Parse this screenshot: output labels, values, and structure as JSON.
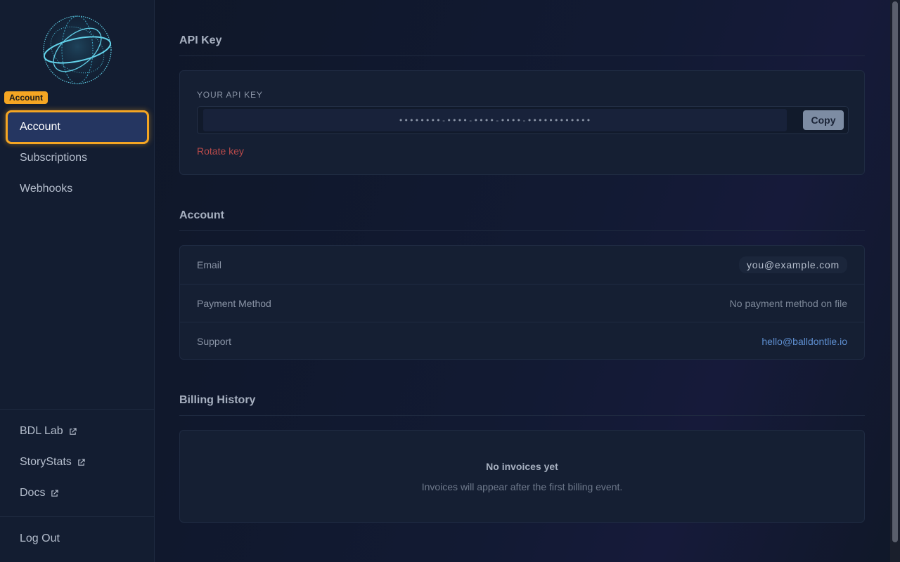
{
  "sidebar": {
    "tooltip": "Account",
    "nav": [
      {
        "label": "Account",
        "active": true
      },
      {
        "label": "Subscriptions",
        "active": false
      },
      {
        "label": "Webhooks",
        "active": false
      }
    ],
    "external_links": [
      {
        "label": "BDL Lab",
        "icon": "external-link-icon"
      },
      {
        "label": "StoryStats",
        "icon": "external-link-icon"
      },
      {
        "label": "Docs",
        "icon": "external-link-icon"
      }
    ],
    "logout_label": "Log Out"
  },
  "api_key": {
    "section_title": "API Key",
    "field_label": "YOUR API KEY",
    "masked_value": "••••••••-••••-••••-••••-••••••••••••",
    "copy_label": "Copy",
    "rotate_label": "Rotate key"
  },
  "account": {
    "section_title": "Account",
    "rows": [
      {
        "label": "Email",
        "value": "you@example.com"
      },
      {
        "label": "Payment Method",
        "value": "No payment method on file"
      },
      {
        "label": "Support",
        "value": "hello@balldontlie.io"
      }
    ]
  },
  "billing": {
    "section_title": "Billing History",
    "empty_title": "No invoices yet",
    "empty_subtitle": "Invoices will appear after the first billing event."
  },
  "colors": {
    "accent_highlight": "#f5a623",
    "active_nav_bg": "#253661",
    "danger": "#b84a4a",
    "link": "#5e8fd1"
  }
}
